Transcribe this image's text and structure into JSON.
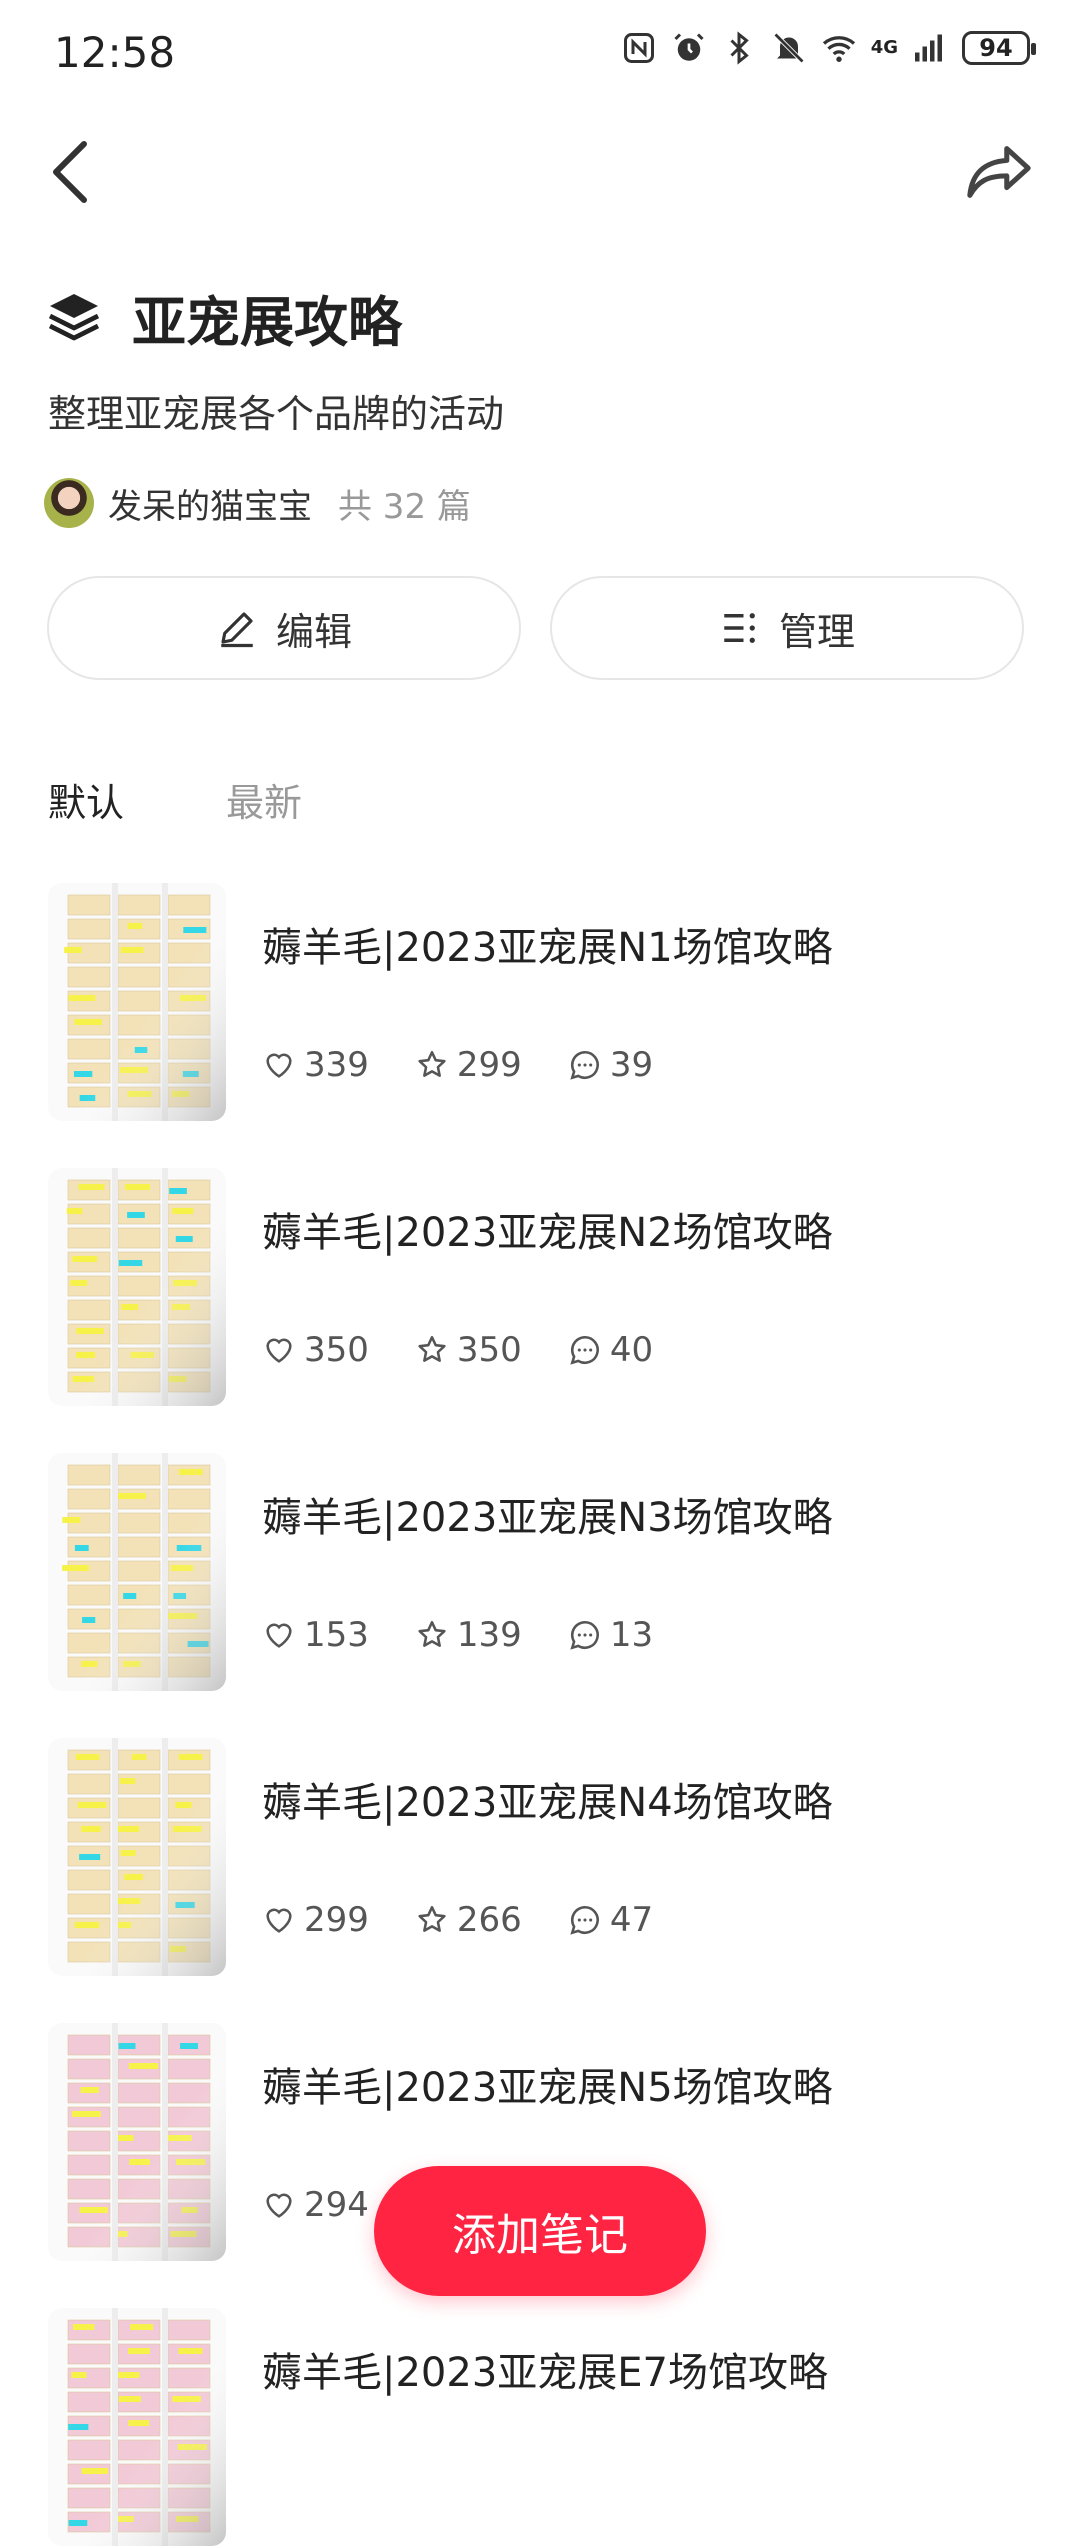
{
  "status_bar": {
    "time": "12:58",
    "battery": "94",
    "network": "4G"
  },
  "header": {
    "title": "亚宠展攻略",
    "subtitle": "整理亚宠展各个品牌的活动"
  },
  "author": {
    "name": "发呆的猫宝宝",
    "count": "共 32 篇"
  },
  "actions": {
    "edit_label": "编辑",
    "manage_label": "管理"
  },
  "tabs": [
    {
      "label": "默认"
    },
    {
      "label": "最新"
    }
  ],
  "notes": [
    {
      "title": "薅羊毛|2023亚宠展N1场馆攻略",
      "likes": "339",
      "stars": "299",
      "comments": "39",
      "theme": "#f3e2b8"
    },
    {
      "title": "薅羊毛|2023亚宠展N2场馆攻略",
      "likes": "350",
      "stars": "350",
      "comments": "40",
      "theme": "#f3e2b8"
    },
    {
      "title": "薅羊毛|2023亚宠展N3场馆攻略",
      "likes": "153",
      "stars": "139",
      "comments": "13",
      "theme": "#f3e2b8"
    },
    {
      "title": "薅羊毛|2023亚宠展N4场馆攻略",
      "likes": "299",
      "stars": "266",
      "comments": "47",
      "theme": "#f3e2b8"
    },
    {
      "title": "薅羊毛|2023亚宠展N5场馆攻略",
      "likes": "294",
      "stars": "",
      "comments": "",
      "theme": "#f2c9d6"
    },
    {
      "title": "薅羊毛|2023亚宠展E7场馆攻略",
      "likes": "",
      "stars": "",
      "comments": "",
      "theme": "#f2c9d6"
    }
  ],
  "fab": {
    "label": "添加笔记"
  },
  "colors": {
    "accent": "#ff2442"
  }
}
